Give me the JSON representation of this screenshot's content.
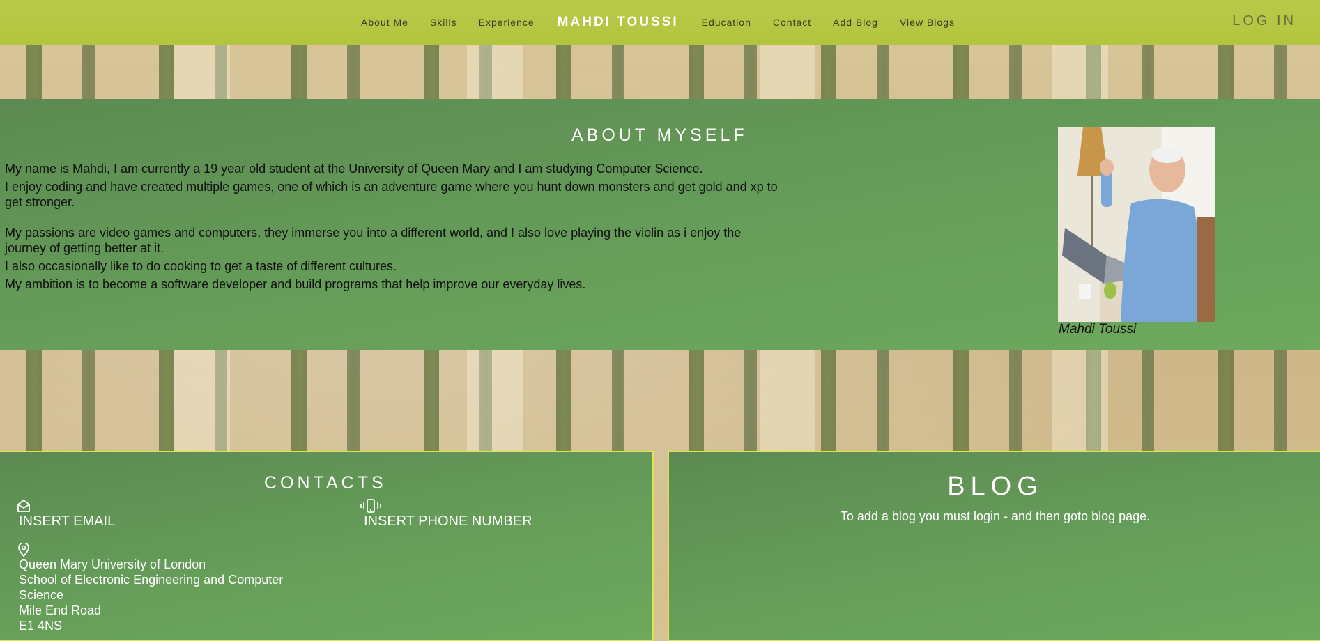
{
  "nav": {
    "links_left": [
      "About Me",
      "Skills",
      "Experience"
    ],
    "brand": "MAHDI TOUSSI",
    "links_right": [
      "Education",
      "Contact",
      "Add Blog",
      "View Blogs"
    ],
    "login": "LOG IN"
  },
  "about": {
    "title": "ABOUT MYSELF",
    "paragraphs": [
      "My name is Mahdi, I am currently a 19 year old student at the University of Queen Mary and I am studying Computer Science.",
      "I enjoy coding and have created multiple games, one of which is an adventure game where you hunt down monsters and get gold and xp to get stronger.",
      "My passions are video games and computers, they immerse you into a different world, and I also love playing the violin as i enjoy the journey of getting better at it.",
      "I also occasionally like to do cooking to get a taste of different cultures.",
      "My ambition is to become a software developer and build programs that help improve our everyday lives."
    ],
    "photo_caption": "Mahdi Toussi"
  },
  "contacts": {
    "title": "CONTACTS",
    "email": "INSERT EMAIL",
    "phone": "INSERT PHONE NUMBER",
    "address": [
      "Queen Mary University of London",
      "School of Electronic Engineering and Computer Science",
      "Mile End Road",
      "E1 4NS"
    ],
    "icons": {
      "email": "envelope-open-icon",
      "phone": "phone-vibrate-icon",
      "address": "location-pin-icon"
    }
  },
  "blog": {
    "title": "BLOG",
    "message": "To add a blog you must login - and then goto blog page."
  },
  "colors": {
    "navbar": "#b6c744",
    "panel_green": "#669e5a",
    "panel_border": "#e2e24a"
  }
}
